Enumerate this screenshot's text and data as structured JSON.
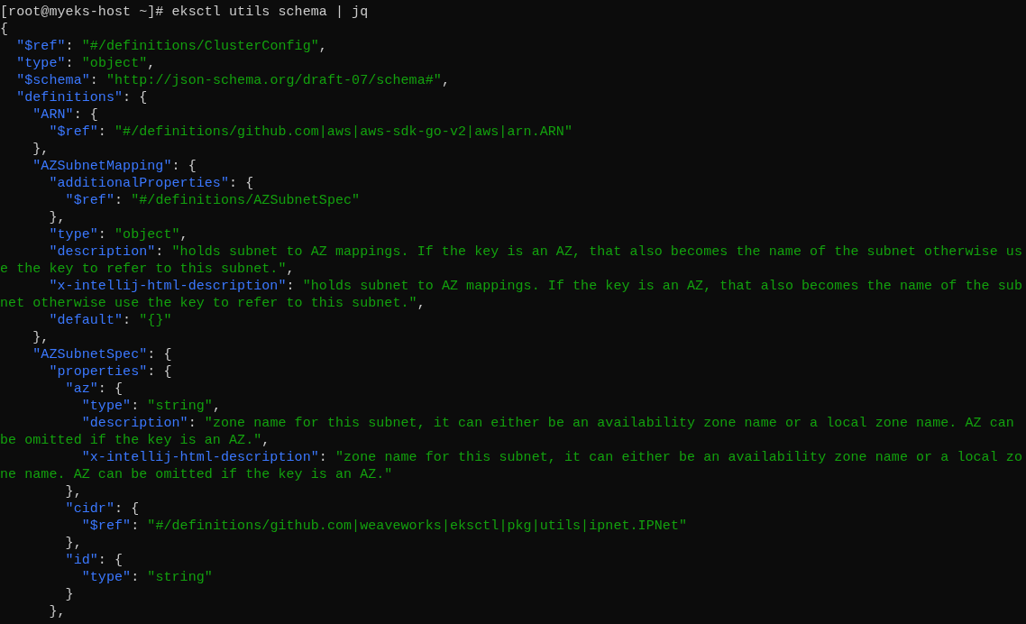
{
  "terminal": {
    "lines": [
      [
        {
          "kind": "plain",
          "text": "[root@myeks-host ~]# eksctl utils schema | jq"
        }
      ],
      [
        {
          "kind": "plain",
          "text": "{"
        }
      ],
      [
        {
          "kind": "key",
          "text": "  \"$ref\""
        },
        {
          "kind": "plain",
          "text": ": "
        },
        {
          "kind": "string",
          "text": "\"#/definitions/ClusterConfig\""
        },
        {
          "kind": "plain",
          "text": ","
        }
      ],
      [
        {
          "kind": "key",
          "text": "  \"type\""
        },
        {
          "kind": "plain",
          "text": ": "
        },
        {
          "kind": "string",
          "text": "\"object\""
        },
        {
          "kind": "plain",
          "text": ","
        }
      ],
      [
        {
          "kind": "key",
          "text": "  \"$schema\""
        },
        {
          "kind": "plain",
          "text": ": "
        },
        {
          "kind": "string",
          "text": "\"http://json-schema.org/draft-07/schema#\""
        },
        {
          "kind": "plain",
          "text": ","
        }
      ],
      [
        {
          "kind": "key",
          "text": "  \"definitions\""
        },
        {
          "kind": "plain",
          "text": ": {"
        }
      ],
      [
        {
          "kind": "key",
          "text": "    \"ARN\""
        },
        {
          "kind": "plain",
          "text": ": {"
        }
      ],
      [
        {
          "kind": "key",
          "text": "      \"$ref\""
        },
        {
          "kind": "plain",
          "text": ": "
        },
        {
          "kind": "string",
          "text": "\"#/definitions/github.com|aws|aws-sdk-go-v2|aws|arn.ARN\""
        }
      ],
      [
        {
          "kind": "plain",
          "text": "    },"
        }
      ],
      [
        {
          "kind": "key",
          "text": "    \"AZSubnetMapping\""
        },
        {
          "kind": "plain",
          "text": ": {"
        }
      ],
      [
        {
          "kind": "key",
          "text": "      \"additionalProperties\""
        },
        {
          "kind": "plain",
          "text": ": {"
        }
      ],
      [
        {
          "kind": "key",
          "text": "        \"$ref\""
        },
        {
          "kind": "plain",
          "text": ": "
        },
        {
          "kind": "string",
          "text": "\"#/definitions/AZSubnetSpec\""
        }
      ],
      [
        {
          "kind": "plain",
          "text": "      },"
        }
      ],
      [
        {
          "kind": "key",
          "text": "      \"type\""
        },
        {
          "kind": "plain",
          "text": ": "
        },
        {
          "kind": "string",
          "text": "\"object\""
        },
        {
          "kind": "plain",
          "text": ","
        }
      ],
      [
        {
          "kind": "key",
          "text": "      \"description\""
        },
        {
          "kind": "plain",
          "text": ": "
        },
        {
          "kind": "string",
          "text": "\"holds subnet to AZ mappings. If the key is an AZ, that also becomes the name of the subnet otherwise us"
        }
      ],
      [
        {
          "kind": "string",
          "text": "e the key to refer to this subnet.\""
        },
        {
          "kind": "plain",
          "text": ","
        }
      ],
      [
        {
          "kind": "key",
          "text": "      \"x-intellij-html-description\""
        },
        {
          "kind": "plain",
          "text": ": "
        },
        {
          "kind": "string",
          "text": "\"holds subnet to AZ mappings. If the key is an AZ, that also becomes the name of the sub"
        }
      ],
      [
        {
          "kind": "string",
          "text": "net otherwise use the key to refer to this subnet.\""
        },
        {
          "kind": "plain",
          "text": ","
        }
      ],
      [
        {
          "kind": "key",
          "text": "      \"default\""
        },
        {
          "kind": "plain",
          "text": ": "
        },
        {
          "kind": "string",
          "text": "\"{}\""
        }
      ],
      [
        {
          "kind": "plain",
          "text": "    },"
        }
      ],
      [
        {
          "kind": "key",
          "text": "    \"AZSubnetSpec\""
        },
        {
          "kind": "plain",
          "text": ": {"
        }
      ],
      [
        {
          "kind": "key",
          "text": "      \"properties\""
        },
        {
          "kind": "plain",
          "text": ": {"
        }
      ],
      [
        {
          "kind": "key",
          "text": "        \"az\""
        },
        {
          "kind": "plain",
          "text": ": {"
        }
      ],
      [
        {
          "kind": "key",
          "text": "          \"type\""
        },
        {
          "kind": "plain",
          "text": ": "
        },
        {
          "kind": "string",
          "text": "\"string\""
        },
        {
          "kind": "plain",
          "text": ","
        }
      ],
      [
        {
          "kind": "key",
          "text": "          \"description\""
        },
        {
          "kind": "plain",
          "text": ": "
        },
        {
          "kind": "string",
          "text": "\"zone name for this subnet, it can either be an availability zone name or a local zone name. AZ can"
        }
      ],
      [
        {
          "kind": "string",
          "text": "be omitted if the key is an AZ.\""
        },
        {
          "kind": "plain",
          "text": ","
        }
      ],
      [
        {
          "kind": "key",
          "text": "          \"x-intellij-html-description\""
        },
        {
          "kind": "plain",
          "text": ": "
        },
        {
          "kind": "string",
          "text": "\"zone name for this subnet, it can either be an availability zone name or a local zo"
        }
      ],
      [
        {
          "kind": "string",
          "text": "ne name. AZ can be omitted if the key is an AZ.\""
        }
      ],
      [
        {
          "kind": "plain",
          "text": "        },"
        }
      ],
      [
        {
          "kind": "key",
          "text": "        \"cidr\""
        },
        {
          "kind": "plain",
          "text": ": {"
        }
      ],
      [
        {
          "kind": "key",
          "text": "          \"$ref\""
        },
        {
          "kind": "plain",
          "text": ": "
        },
        {
          "kind": "string",
          "text": "\"#/definitions/github.com|weaveworks|eksctl|pkg|utils|ipnet.IPNet\""
        }
      ],
      [
        {
          "kind": "plain",
          "text": "        },"
        }
      ],
      [
        {
          "kind": "key",
          "text": "        \"id\""
        },
        {
          "kind": "plain",
          "text": ": {"
        }
      ],
      [
        {
          "kind": "key",
          "text": "          \"type\""
        },
        {
          "kind": "plain",
          "text": ": "
        },
        {
          "kind": "string",
          "text": "\"string\""
        }
      ],
      [
        {
          "kind": "plain",
          "text": "        }"
        }
      ],
      [
        {
          "kind": "plain",
          "text": "      },"
        }
      ]
    ]
  }
}
